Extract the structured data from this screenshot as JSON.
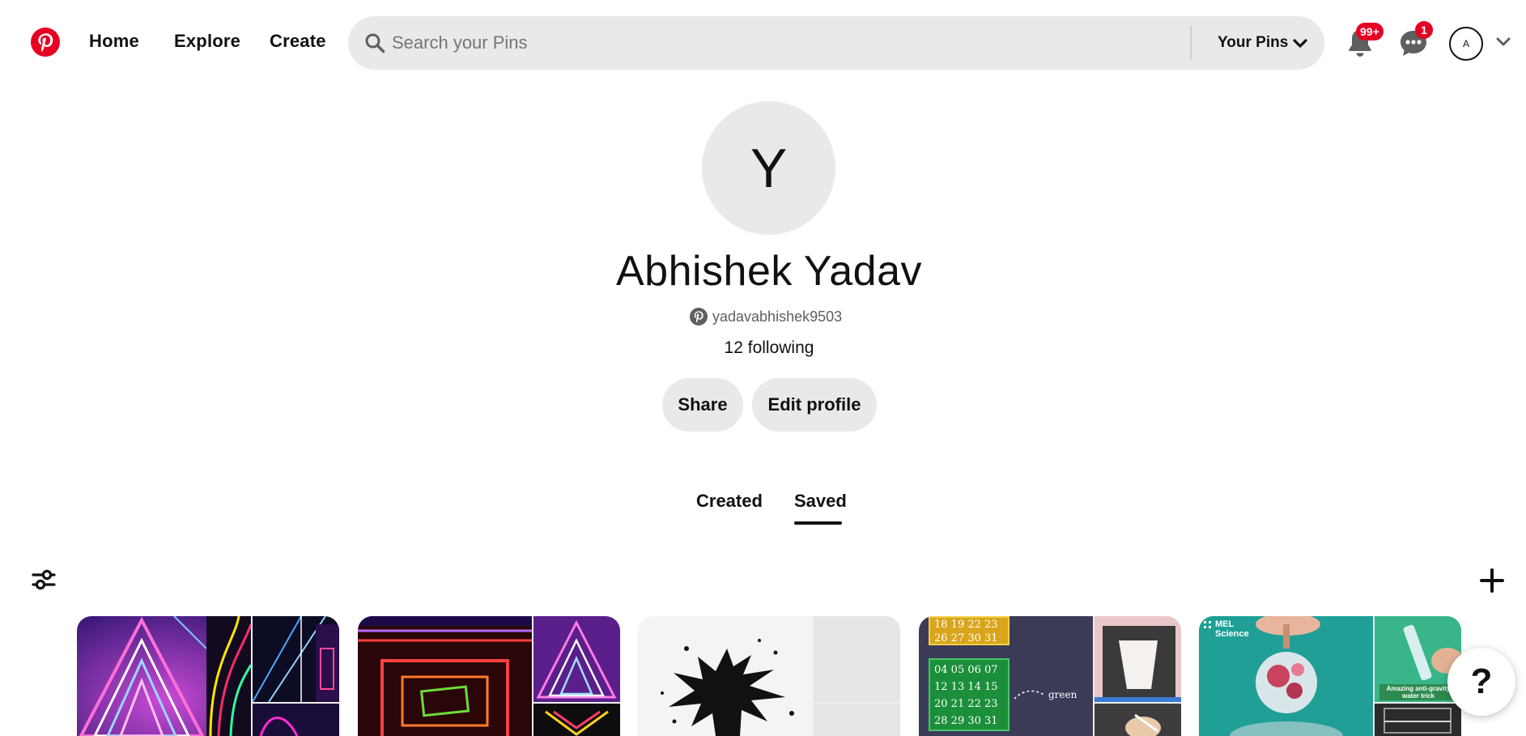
{
  "header": {
    "logo_icon": "pinterest-logo-icon",
    "nav": {
      "home": "Home",
      "explore": "Explore",
      "create": "Create"
    },
    "search": {
      "placeholder": "Search your Pins",
      "value": "",
      "scope": "Your Pins",
      "icon": "search-icon"
    },
    "notifications": {
      "icon": "bell-icon",
      "badge": "99+"
    },
    "messages": {
      "icon": "chat-bubble-icon",
      "badge": "1"
    },
    "account": {
      "initial": "A",
      "menu_icon": "chevron-down-icon"
    }
  },
  "profile": {
    "avatar_initial": "Y",
    "name": "Abhishek Yadav",
    "username": "yadavabhishek9503",
    "following": "12 following",
    "share_label": "Share",
    "edit_label": "Edit profile"
  },
  "tabs": {
    "created": "Created",
    "saved": "Saved",
    "active": "Saved"
  },
  "toolbar": {
    "filter_icon": "sliders-icon",
    "add_icon": "plus-icon"
  },
  "boards": [
    {
      "theme": "neon-triangles"
    },
    {
      "theme": "neon-rectangles"
    },
    {
      "theme": "ink-splatter"
    },
    {
      "theme": "math-numbers",
      "rows_top": [
        "18 19 22 23",
        "26 27 30 31"
      ],
      "rows_green": [
        "04 05 06 07",
        "12 13 14 15",
        "20 21 22 23",
        "28 29 30 31"
      ],
      "word": "green"
    },
    {
      "theme": "mel-science",
      "brand": "MEL",
      "brand2": "Science",
      "caption_line1": "Amazing anti-gravity",
      "caption_line2": "water trick"
    }
  ],
  "help": {
    "label": "?"
  },
  "colors": {
    "brand_red": "#e60023",
    "pill_gray": "#e9e9e9",
    "text": "#111111"
  }
}
